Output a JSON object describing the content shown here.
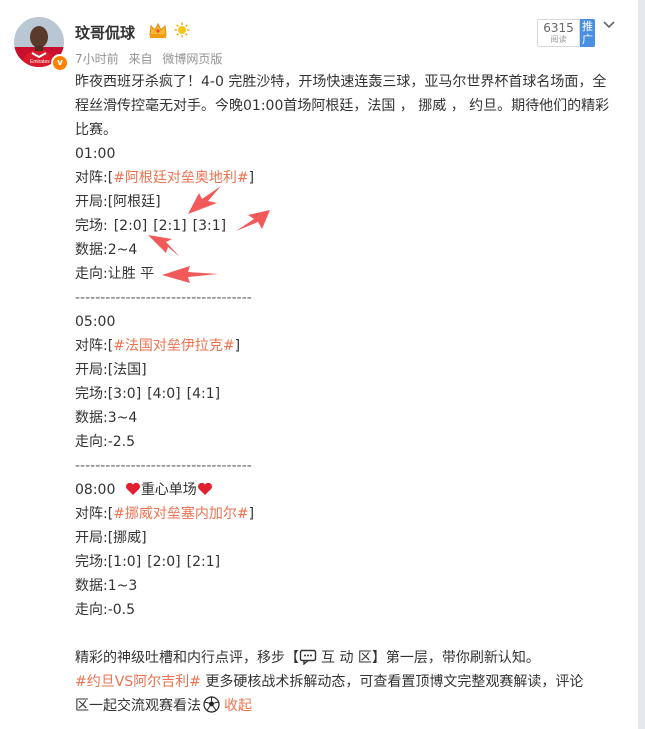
{
  "user": {
    "name": "玟哥侃球",
    "time": "7小时前",
    "source_prefix": "来自",
    "source": "微博网页版"
  },
  "stats": {
    "reads": "6315",
    "reads_label": "阅读",
    "promote": "推广"
  },
  "post": {
    "intro": "昨夜西班牙杀疯了！4-0 完胜沙特，开场快速连轰三球，亚马尔世界杯首球名场面，全程丝滑传控毫无对手。今晚01:00首场阿根廷，法国 ， 挪威 ， 约旦。期待他们的精彩比赛。",
    "divider": "-----------------------------------",
    "matches": [
      {
        "time": "01:00",
        "time_extra": "",
        "vs_label": "对阵:[",
        "vs_tag": "#阿根廷对垒奥地利#",
        "vs_close": "]",
        "open": "开局:[阿根廷]",
        "score_label": "完场:",
        "scores": [
          "[2:0]",
          "[2:1]",
          "[3:1]"
        ],
        "data": "数据:2~4",
        "trend": "走向:让胜 平"
      },
      {
        "time": "05:00",
        "time_extra": "",
        "vs_label": "对阵:[",
        "vs_tag": "#法国对垒伊拉克#",
        "vs_close": "]",
        "open": "开局:[法国]",
        "score_label": "完场:",
        "scores": [
          "[3:0]",
          "[4:0]",
          "[4:1]"
        ],
        "data": "数据:3~4",
        "trend": "走向:-2.5"
      },
      {
        "time": "08:00",
        "time_extra": "重心单场",
        "vs_label": "对阵:[",
        "vs_tag": "#挪威对垒塞内加尔#",
        "vs_close": "]",
        "open": "开局:[挪威]",
        "score_label": "完场:",
        "scores": [
          "[1:0]",
          "[2:0]",
          "[2:1]"
        ],
        "data": "数据:1~3",
        "trend": "走向:-0.5"
      }
    ],
    "footer_text_1": "精彩的神级吐槽和内行点评，移步【",
    "footer_interact": "互 动 区",
    "footer_text_2": "】第一层，带你刷新认知。",
    "footer_tag": "#约旦VS阿尔吉利#",
    "footer_text_3": " 更多硬核战术拆解动态，可查看置顶博文完整观赛解读，评论",
    "footer_text_4": "区一起交流观赛看法",
    "collapse": "收起"
  },
  "colors": {
    "hashtag": "#eb7350",
    "arrow": "#f25a5a",
    "accent_blue": "#4a90e2"
  },
  "icons": {
    "heart": "red-heart-icon",
    "comment": "speech-bubble-icon",
    "ball": "soccer-ball-icon",
    "crown": "crown-badge-icon",
    "sun": "sun-badge-icon",
    "chevron": "chevron-down-icon"
  }
}
